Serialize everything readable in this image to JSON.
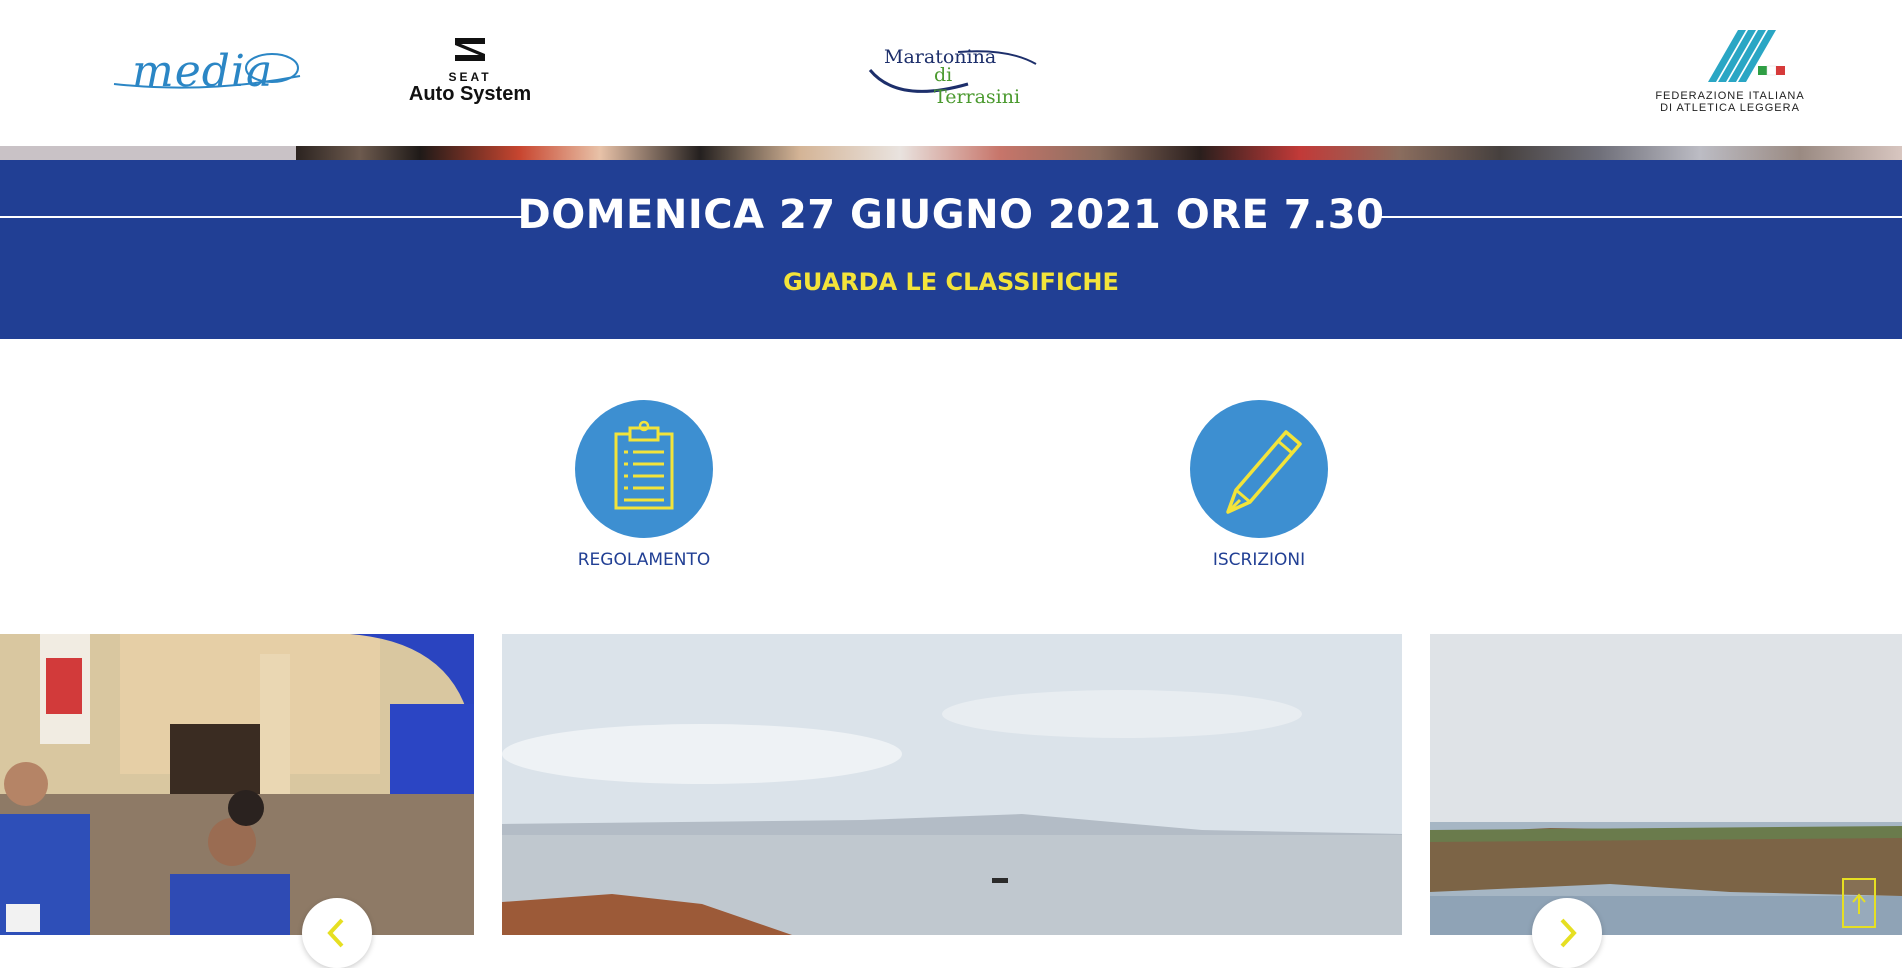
{
  "sponsors": {
    "media_logo": "media",
    "seat_logo": {
      "brand": "SEAT",
      "name": "Auto System"
    },
    "maratonina_logo": {
      "line1": "Maratonina",
      "line2": "di Terrasini"
    },
    "fidal_logo": {
      "line1": "FEDERAZIONE ITALIANA",
      "line2": "DI ATLETICA LEGGERA"
    }
  },
  "banner": {
    "date": "DOMENICA 27 GIUGNO 2021 ORE 7.30",
    "results_link": "GUARDA LE CLASSIFICHE"
  },
  "features": [
    {
      "label": "REGOLAMENTO",
      "icon": "clipboard-icon"
    },
    {
      "label": "ISCRIZIONI",
      "icon": "pencil-icon"
    }
  ],
  "carousel": {
    "slides": [
      {
        "subject": "runners-finish-photo"
      },
      {
        "subject": "coast-sea-photo"
      },
      {
        "subject": "rocky-shore-photo"
      }
    ],
    "prev_icon": "chevron-left-icon",
    "next_icon": "chevron-right-icon"
  },
  "colors": {
    "banner_blue": "#213f94",
    "accent_yellow": "#f3e43a",
    "icon_circle_blue": "#3d8fd1",
    "label_blue": "#213f94"
  }
}
